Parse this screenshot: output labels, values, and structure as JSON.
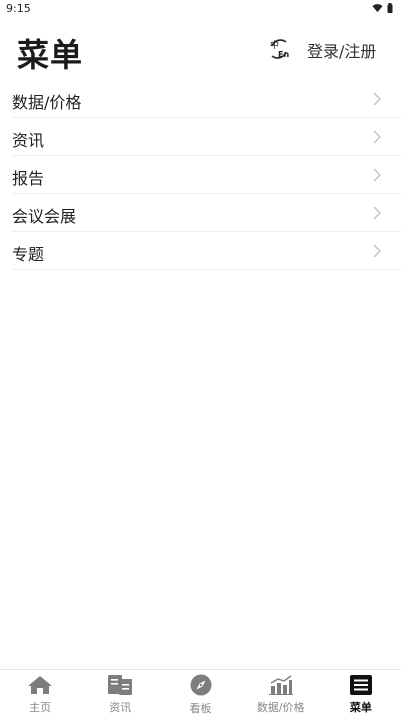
{
  "status_bar": {
    "time": "9:15"
  },
  "header": {
    "title": "菜单",
    "login": "登录/注册",
    "lang_icon": "language-switch-icon"
  },
  "menu": {
    "items": [
      {
        "label": "数据/价格"
      },
      {
        "label": "资讯"
      },
      {
        "label": "报告"
      },
      {
        "label": "会议会展"
      },
      {
        "label": "专题"
      }
    ]
  },
  "tab_bar": {
    "tabs": [
      {
        "label": "主页",
        "icon": "home-icon"
      },
      {
        "label": "资讯",
        "icon": "news-icon"
      },
      {
        "label": "看板",
        "icon": "compass-icon"
      },
      {
        "label": "数据/价格",
        "icon": "bar-chart-icon"
      },
      {
        "label": "菜单",
        "icon": "menu-icon"
      }
    ],
    "active_index": 4
  },
  "colors": {
    "text": "#222222",
    "divider": "#ededed",
    "inactive_tab": "#888888",
    "active_tab": "#111111"
  }
}
